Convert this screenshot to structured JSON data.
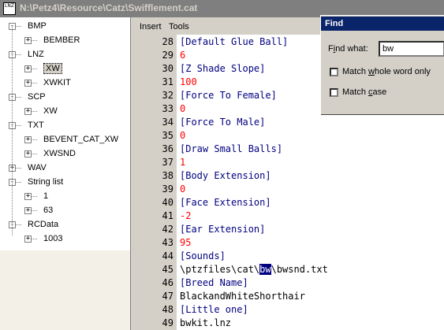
{
  "window": {
    "title": "N:\\Petz4\\Resource\\Catz\\Swifflement.cat",
    "icon": "lnz-file-icon",
    "icon_text": "LNZ"
  },
  "menu": [
    "Insert",
    "Tools"
  ],
  "tree": {
    "nodes": [
      {
        "label": "BMP",
        "depth": 0,
        "toggle": "-"
      },
      {
        "label": "BEMBER",
        "depth": 1,
        "toggle": "+"
      },
      {
        "label": "LNZ",
        "depth": 0,
        "toggle": "-"
      },
      {
        "label": "XW",
        "depth": 1,
        "toggle": "+",
        "selected": true
      },
      {
        "label": "XWKIT",
        "depth": 1,
        "toggle": "+"
      },
      {
        "label": "SCP",
        "depth": 0,
        "toggle": "-"
      },
      {
        "label": "XW",
        "depth": 1,
        "toggle": "+"
      },
      {
        "label": "TXT",
        "depth": 0,
        "toggle": "-"
      },
      {
        "label": "BEVENT_CAT_XW",
        "depth": 1,
        "toggle": "+"
      },
      {
        "label": "XWSND",
        "depth": 1,
        "toggle": "+"
      },
      {
        "label": "WAV",
        "depth": 0,
        "toggle": "+"
      },
      {
        "label": "String list",
        "depth": 0,
        "toggle": "-"
      },
      {
        "label": "1",
        "depth": 1,
        "toggle": "+"
      },
      {
        "label": "63",
        "depth": 1,
        "toggle": "+"
      },
      {
        "label": "RCData",
        "depth": 0,
        "toggle": "-"
      },
      {
        "label": "1003",
        "depth": 1,
        "toggle": "+"
      }
    ]
  },
  "editor": {
    "lines": [
      {
        "n": "28",
        "text": "[Default Glue Ball]",
        "kind": "sec"
      },
      {
        "n": "29",
        "text": "6",
        "kind": "val"
      },
      {
        "n": "30",
        "text": "[Z Shade Slope]",
        "kind": "sec"
      },
      {
        "n": "31",
        "text": "100",
        "kind": "val"
      },
      {
        "n": "32",
        "text": "[Force To Female]",
        "kind": "sec"
      },
      {
        "n": "33",
        "text": "0",
        "kind": "val"
      },
      {
        "n": "34",
        "text": "[Force To Male]",
        "kind": "sec"
      },
      {
        "n": "35",
        "text": "0",
        "kind": "val"
      },
      {
        "n": "36",
        "text": "[Draw Small Balls]",
        "kind": "sec"
      },
      {
        "n": "37",
        "text": "1",
        "kind": "val"
      },
      {
        "n": "38",
        "text": "[Body Extension]",
        "kind": "sec"
      },
      {
        "n": "39",
        "text": "0",
        "kind": "val"
      },
      {
        "n": "40",
        "text": "[Face Extension]",
        "kind": "sec"
      },
      {
        "n": "41",
        "text": "-2",
        "kind": "val"
      },
      {
        "n": "42",
        "text": "[Ear Extension]",
        "kind": "sec"
      },
      {
        "n": "43",
        "text": "95",
        "kind": "val"
      },
      {
        "n": "44",
        "text": "[Sounds]",
        "kind": "sec"
      },
      {
        "n": "45",
        "text": "",
        "kind": "plain",
        "pre": "\\ptzfiles\\cat\\",
        "match": "bw",
        "post": "\\bwsnd.txt"
      },
      {
        "n": "46",
        "text": "[Breed Name]",
        "kind": "sec"
      },
      {
        "n": "47",
        "text": "BlackandWhiteShorthair",
        "kind": "plain"
      },
      {
        "n": "48",
        "text": "[Little one]",
        "kind": "sec"
      },
      {
        "n": "49",
        "text": "bwkit.lnz",
        "kind": "plain"
      }
    ]
  },
  "find": {
    "title": "Find",
    "label_pre": "F",
    "label_ul": "i",
    "label_post": "nd what:",
    "value": "bw",
    "whole_word_pre": "Match ",
    "whole_word_ul": "w",
    "whole_word_post": "hole word only",
    "case_pre": "Match ",
    "case_ul": "c",
    "case_post": "ase",
    "whole_word_checked": false,
    "case_checked": false
  }
}
